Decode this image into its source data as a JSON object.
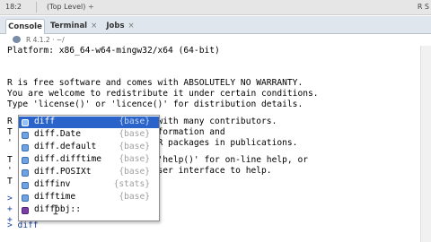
{
  "statusbar": {
    "position": "18:2",
    "scope": "(Top Level) ÷",
    "language": "R S"
  },
  "tabs": [
    {
      "label": "Console",
      "active": true
    },
    {
      "label": "Terminal",
      "close": "×"
    },
    {
      "label": "Jobs",
      "close": "×"
    }
  ],
  "pathbar": {
    "version": "R 4.1.2 · ~/"
  },
  "console": {
    "lines": [
      "Platform: x86_64-w64-mingw32/x64 (64-bit)",
      "",
      "R is free software and comes with ABSOLUTELY NO WARRANTY.",
      "You are welcome to redistribute it under certain conditions.",
      "Type 'license()' or 'licence()' for distribution details.",
      "",
      "R is a collaborative project with many contributors.",
      "T                       re information and",
      "'                       R or R packages in publications.",
      "",
      "T                         s, 'help()' for on-line help, or",
      "'                         rowser interface to help.",
      "T",
      "",
      ">                         ){",
      "+",
      "+",
      "> diff"
    ]
  },
  "autocomplete": {
    "items": [
      {
        "name": "diff",
        "package": "{base}",
        "selected": true,
        "icon": "function-icon"
      },
      {
        "name": "diff.Date",
        "package": "{base}",
        "icon": "function-icon"
      },
      {
        "name": "diff.default",
        "package": "{base}",
        "icon": "function-icon"
      },
      {
        "name": "diff.difftime",
        "package": "{base}",
        "icon": "function-icon"
      },
      {
        "name": "diff.POSIXt",
        "package": "{base}",
        "icon": "function-icon"
      },
      {
        "name": "diffinv",
        "package": "{stats}",
        "icon": "function-icon"
      },
      {
        "name": "difftime",
        "package": "{base}",
        "icon": "function-icon"
      },
      {
        "name": "diffobj::",
        "package": "",
        "icon": "package-icon"
      }
    ]
  },
  "colors": {
    "selection": "#2a63c9",
    "prompt": "#1a3fa0",
    "tabbar": "#dfe6ed"
  }
}
